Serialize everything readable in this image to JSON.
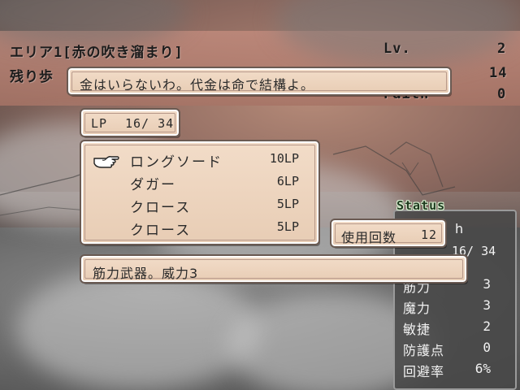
{
  "hud": {
    "area_title": "エリア1[赤の吹き溜まり]",
    "remaining_label": "残り歩",
    "level_label": "Lv.",
    "level_value": "2",
    "steps_value": "14",
    "faith_label": "Faith",
    "faith_value": "0"
  },
  "dialogue": {
    "message": "金はいらないわ。代金は命で結構よ。"
  },
  "lp_box": {
    "label": "LP",
    "value": "16/ 34"
  },
  "shop": {
    "items": [
      {
        "name": "ロングソード",
        "cost": "10LP",
        "selected": true
      },
      {
        "name": "ダガー",
        "cost": "6LP",
        "selected": false
      },
      {
        "name": "クロース",
        "cost": "5LP",
        "selected": false
      },
      {
        "name": "クロース",
        "cost": "5LP",
        "selected": false
      }
    ],
    "cursor_icon": "pointing-hand-icon"
  },
  "uses_box": {
    "label": "使用回数",
    "value": "12"
  },
  "description": {
    "text": "筋力武器。威力3"
  },
  "status": {
    "title": "Status",
    "header_partial": "h",
    "lp_partial": "16/ 34",
    "rows": [
      {
        "label": "筋力",
        "value": "3"
      },
      {
        "label": "魔力",
        "value": "3"
      },
      {
        "label": "敏捷",
        "value": "2"
      },
      {
        "label": "防護点",
        "value": "0"
      },
      {
        "label": "回避率",
        "value": "6%"
      }
    ]
  },
  "colors": {
    "window_fill": "#f0d8c2",
    "window_border": "#6a5a52",
    "status_title_green": "#1e3a1e",
    "text_dark": "#2a2a2a"
  }
}
